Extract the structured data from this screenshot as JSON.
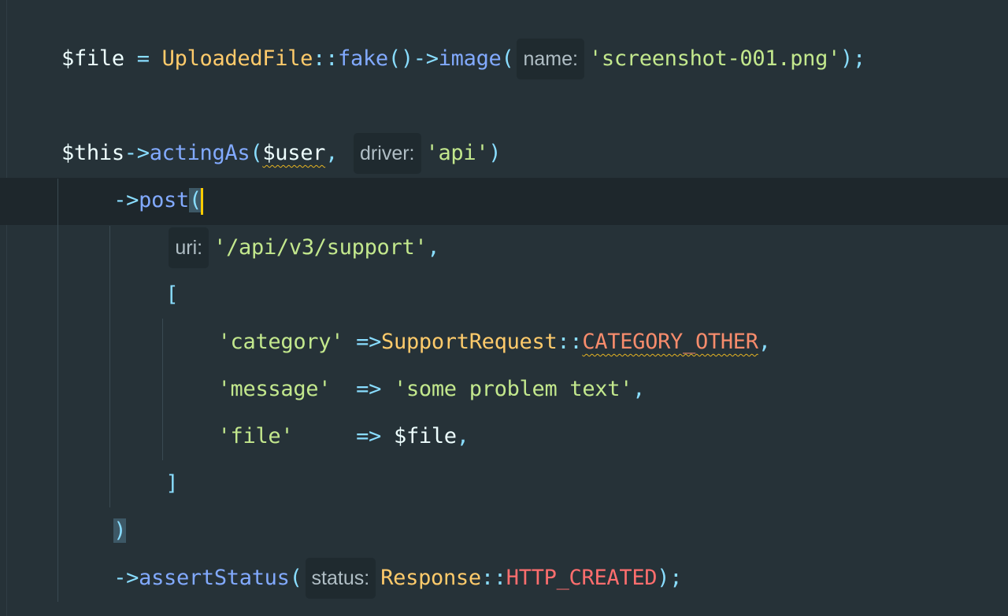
{
  "editor": {
    "lines": [
      {
        "indent": 0,
        "tokens": [
          [
            "var",
            "$file"
          ],
          [
            "op",
            " = "
          ],
          [
            "cls",
            "UploadedFile"
          ],
          [
            "op",
            "::"
          ],
          [
            "fn",
            "fake"
          ],
          [
            "op",
            "()->"
          ],
          [
            "fn",
            "image"
          ],
          [
            "op",
            "("
          ],
          [
            "hint",
            "name:"
          ],
          [
            "str",
            "'screenshot-001.png'"
          ],
          [
            "op",
            ");"
          ]
        ]
      },
      {
        "indent": 0,
        "tokens": []
      },
      {
        "indent": 0,
        "tokens": [
          [
            "var",
            "$this"
          ],
          [
            "op",
            "->"
          ],
          [
            "fn",
            "actingAs"
          ],
          [
            "op",
            "("
          ],
          [
            "var warn",
            "$user"
          ],
          [
            "op",
            ", "
          ],
          [
            "hint",
            "driver:"
          ],
          [
            "str",
            "'api'"
          ],
          [
            "op",
            ")"
          ]
        ]
      },
      {
        "indent": 4,
        "tokens": [
          [
            "op",
            "->"
          ],
          [
            "fn",
            "post"
          ],
          [
            "op match",
            "("
          ],
          [
            "caret",
            ""
          ]
        ]
      },
      {
        "indent": 8,
        "tokens": [
          [
            "hint",
            "uri:"
          ],
          [
            "str",
            "'/api/v3/support'"
          ],
          [
            "op",
            ","
          ]
        ]
      },
      {
        "indent": 8,
        "tokens": [
          [
            "op",
            "["
          ]
        ]
      },
      {
        "indent": 12,
        "tokens": [
          [
            "str",
            "'category'"
          ],
          [
            "op",
            " =>"
          ],
          [
            "cls",
            "SupportRequest"
          ],
          [
            "op",
            "::"
          ],
          [
            "const warn",
            "CATEGORY_OTHER"
          ],
          [
            "op",
            ","
          ]
        ]
      },
      {
        "indent": 12,
        "tokens": [
          [
            "str",
            "'message'"
          ],
          [
            "op",
            "  => "
          ],
          [
            "str",
            "'some problem text'"
          ],
          [
            "op",
            ","
          ]
        ]
      },
      {
        "indent": 12,
        "tokens": [
          [
            "str",
            "'file'"
          ],
          [
            "op",
            "     => "
          ],
          [
            "var",
            "$file"
          ],
          [
            "op",
            ","
          ]
        ]
      },
      {
        "indent": 8,
        "tokens": [
          [
            "op",
            "]"
          ]
        ]
      },
      {
        "indent": 4,
        "tokens": [
          [
            "op match",
            ")"
          ]
        ]
      },
      {
        "indent": 4,
        "tokens": [
          [
            "op",
            "->"
          ],
          [
            "fn",
            "assertStatus"
          ],
          [
            "op",
            "("
          ],
          [
            "hint",
            "status:"
          ],
          [
            "cls",
            "Response"
          ],
          [
            "op",
            "::"
          ],
          [
            "const2",
            "HTTP_CREATED"
          ],
          [
            "op",
            ");"
          ]
        ]
      }
    ]
  },
  "colors": {
    "background": "#263238",
    "current_line": "#1e272c",
    "caret": "#ffcc00"
  }
}
